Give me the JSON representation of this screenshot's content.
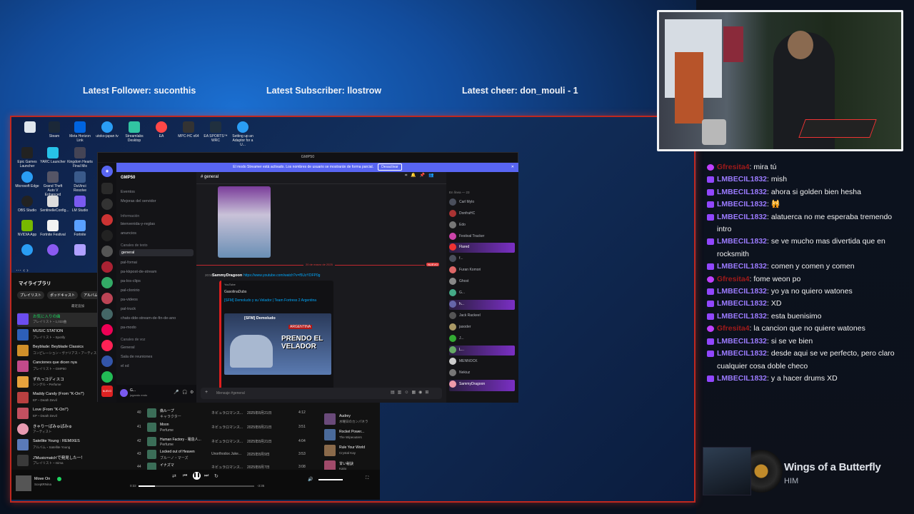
{
  "overlay": {
    "latest_follower": "Latest Follower: suconthis",
    "latest_subscriber": "Latest Subscriber: llostrow",
    "latest_cheer": "Latest cheer: don_mouli - 1"
  },
  "desktop_icons": [
    {
      "label": "Steam"
    },
    {
      "label": "Meta Horizon Link"
    },
    {
      "label": "utoko-japan tv"
    },
    {
      "label": "Streamlabs Desktop"
    },
    {
      "label": "EA"
    },
    {
      "label": "MPC-HC x64"
    },
    {
      "label": "EA SPORTS™ WRC"
    },
    {
      "label": "Setting up an Adaptor for a U..."
    },
    {
      "label": "Epic Games Launcher"
    },
    {
      "label": "YARC Launcher"
    },
    {
      "label": "Kingdom Hearts Final Mix"
    },
    {
      "label": "Microsoft Edge"
    },
    {
      "label": "Grand Theft Auto V Enhanced"
    },
    {
      "label": "DaVinci Resolve"
    },
    {
      "label": "OBS Studio"
    },
    {
      "label": "SentinelleConfig..."
    },
    {
      "label": "LM Studio"
    },
    {
      "label": "NVIDIA App"
    },
    {
      "label": "Fortnite Festival"
    },
    {
      "label": "Fortnite"
    }
  ],
  "spotify": {
    "library_title": "マイライブラリ",
    "filters": [
      "プレイリスト",
      "ポッドキャスト",
      "アルバム"
    ],
    "sort": "最近追加",
    "sidebar": [
      {
        "title": "お気に入りの曲",
        "sub": "プレイリスト・1,033曲",
        "color": "#6b4df0"
      },
      {
        "title": "MUSIC STATION",
        "sub": "プレイリスト・Spotify",
        "color": "#2d5fb8"
      },
      {
        "title": "Beyblade: Beyblade Classics",
        "sub": "コンピレーション・ヴァリアス・アーティスト",
        "color": "#d0902a"
      },
      {
        "title": "Canciones que dicen nya",
        "sub": "プレイリスト・GMP50",
        "color": "#c24a8a"
      },
      {
        "title": "ずれっコディスコ",
        "sub": "シングル・Perfume",
        "color": "#e6a23c"
      },
      {
        "title": "Maddy Candy (From \"K-On!\")",
        "sub": "EP・Death Devil",
        "color": "#b84040"
      },
      {
        "title": "Love (From \"K-On!\")",
        "sub": "EP・Death Devil",
        "color": "#c25060"
      },
      {
        "title": "きゃりーぱみゅぱみゅ",
        "sub": "アーティスト",
        "color": "#e89ab0"
      },
      {
        "title": "Satellite Young : REMIXES",
        "sub": "アルバム・Satellite Young",
        "color": "#5a7ab8"
      },
      {
        "title": "J'Musicmatch'で発見した一！",
        "sub": "プレイリスト・mima",
        "color": "#3a3a3a"
      }
    ],
    "now_playing": {
      "title": "Move On",
      "artist": "SceptRNina"
    },
    "tracks": [
      {
        "n": "40",
        "title": "偽ループ",
        "artist": "キャラクター",
        "album": "ネビュラロマンス...",
        "date": "2025年8月21日",
        "dur": "4:12"
      },
      {
        "n": "41",
        "title": "Moon",
        "artist": "Perfume",
        "album": "ネビュラロマンス...",
        "date": "2025年8月21日",
        "dur": "3:51"
      },
      {
        "n": "42",
        "title": "Human Factory - 電造人...",
        "artist": "Perfume",
        "album": "ネビュラロマンス...",
        "date": "2025年8月21日",
        "dur": "4:04"
      },
      {
        "n": "43",
        "title": "Locked out of Heaven",
        "artist": "ブルーノ・マーズ",
        "album": "Unorthodox Juke...",
        "date": "2025年8月9日",
        "dur": "3:53"
      },
      {
        "n": "44",
        "title": "イナズマ",
        "artist": "",
        "album": "ネビュラロマンス...",
        "date": "2025年8月7日",
        "dur": "3:08"
      }
    ],
    "queue": [
      {
        "title": "Audrey",
        "sub": "水曜日のカンパネラ"
      },
      {
        "title": "Rocket Power...",
        "sub": "The Wipeouters"
      },
      {
        "title": "Rule Your World",
        "sub": "Crystal Kay"
      },
      {
        "title": "甘い秘訣",
        "sub": "Kaito"
      }
    ],
    "time_elapsed": "0:32",
    "time_total": "-3:35"
  },
  "discord": {
    "window_title": "GMP50",
    "banner_text": "El modo Streamer está activado. Los nombres de usuario se mostrarán de forma parcial.",
    "banner_button": "Desactivar",
    "server_name": "GMP50",
    "top_items": [
      "Eventos",
      "Mejoras del servidor"
    ],
    "cat_info": "Información",
    "info_channels": [
      "bienvenida-y-reglas",
      "anuncios"
    ],
    "cat_text": "Canales de texto",
    "text_channels": [
      "general",
      "pal-fornai",
      "pa-kkpost-de-stream",
      "pa-los-clips",
      "pal-clonirio",
      "pa-videos",
      "pal-truck",
      "chats-dde-stream-de-fin-de-ano",
      "pa-modo"
    ],
    "cat_voice": "Canales de voz",
    "voice_channels": [
      "General",
      "Sala de reuniones",
      "el xd"
    ],
    "channel_header": "general",
    "search_placeholder": "Buscar GMP50",
    "date_divider": "20 de marzo de 2025",
    "new_badge": "NUEVO",
    "message_time": "20:50",
    "message_author": "SammyDragoon",
    "message_link": "https://www.youtube.com/watch?v=f5UzYDFP0g",
    "embed_site": "YouTube",
    "embed_author": "GasolinaDubs",
    "embed_title": "[SFM] Demoludo y su Velador | Team Fortress 2 Argentina",
    "embed_thumb_title": "[SFM] Demoludo",
    "embed_thumb_big": "PRENDO EL VELADOR",
    "embed_tag": "ARGENTINA",
    "input_placeholder": "Mensaje #general",
    "members_header": "En línea — 23",
    "members": [
      "Carl Mylo",
      "DonfraHC",
      "Edo",
      "Festival Tracker",
      "Flared",
      "f...",
      "Furan Komori",
      "Ghost",
      "G...",
      "h...",
      "Jack Rackeel",
      "jasoder",
      "J...",
      "L...",
      "MENNOCK",
      "Nekiuz",
      "SammyDragoon"
    ],
    "user_name": "G...",
    "user_status": "jugando endo"
  },
  "chat": [
    {
      "user": "Gfresita4",
      "text": "mira tú",
      "badge": "heart",
      "red": true
    },
    {
      "user": "LMBECIL1832",
      "text": "mish"
    },
    {
      "user": "LMBECIL1832",
      "text": "ahora si golden bien hesha"
    },
    {
      "user": "LMBECIL1832",
      "text": "🙀"
    },
    {
      "user": "LMBECIL1832",
      "text": "alatuerca no me esperaba tremendo intro"
    },
    {
      "user": "LMBECIL1832",
      "text": "se ve mucho mas divertida que en rocksmith"
    },
    {
      "user": "LMBECIL1832",
      "text": "comen y comen y comen"
    },
    {
      "user": "Gfresita4",
      "text": "fome weon po",
      "badge": "heart",
      "red": true
    },
    {
      "user": "LMBECIL1832",
      "text": "yo ya no quiero watones"
    },
    {
      "user": "LMBECIL1832",
      "text": "XD"
    },
    {
      "user": "LMBECIL1832",
      "text": "esta buenisimo"
    },
    {
      "user": "Gfresita4",
      "text": "la cancion que no quiere watones",
      "badge": "heart",
      "red": true
    },
    {
      "user": "LMBECIL1832",
      "text": "si se ve bien"
    },
    {
      "user": "LMBECIL1832",
      "text": "desde aqui se ve perfecto, pero claro cualquier cosa doble checo"
    },
    {
      "user": "LMBECIL1832",
      "text": "y a hacer drums XD"
    }
  ],
  "now_playing_widget": {
    "title": "Wings of a Butterfly",
    "artist": "HIM"
  }
}
